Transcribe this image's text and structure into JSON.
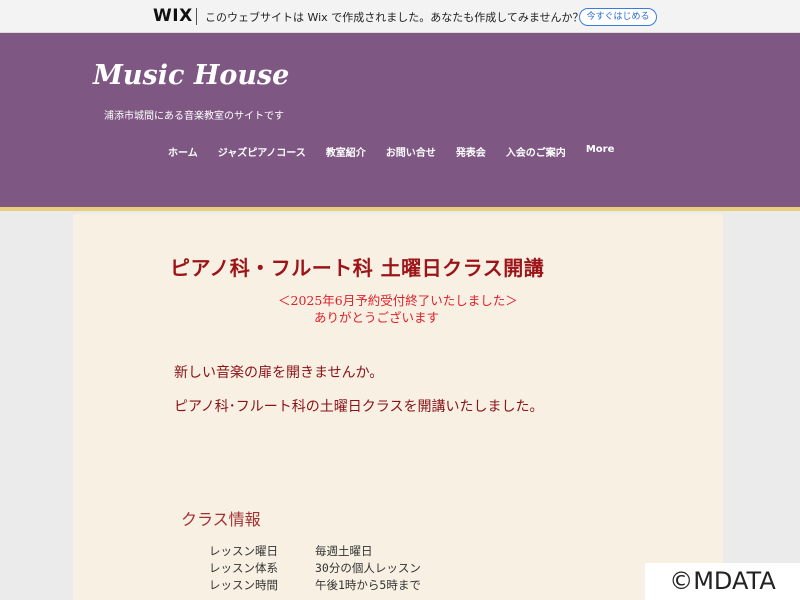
{
  "wix_banner": {
    "logo": "WIX",
    "text": "このウェブサイトは Wix で作成されました。あなたも作成してみませんか？",
    "cta": "今すぐはじめる"
  },
  "header": {
    "title": "Music House",
    "subtitle": "浦添市城間にある音楽教室のサイトです"
  },
  "nav": [
    {
      "label": "ホーム"
    },
    {
      "label": "ジャズピアノコース"
    },
    {
      "label": "教室紹介"
    },
    {
      "label": "お問い合せ"
    },
    {
      "label": "発表会"
    },
    {
      "label": "入会のご案内"
    },
    {
      "label": "More"
    }
  ],
  "main": {
    "heading": "ピアノ科・フルート科 土曜日クラス開講",
    "notice_line1": "＜2025年6月予約受付終了いたしました＞",
    "notice_line2": "ありがとうございます",
    "para1": "新しい音楽の扉を開きませんか。",
    "para2": "ピアノ科･フルート科の土曜日クラスを開講いたしました。",
    "class_info_title": "クラス情報",
    "class_info": [
      {
        "label": "レッスン曜日",
        "value": "毎週土曜日"
      },
      {
        "label": "レッスン体系",
        "value": "30分の個人レッスン"
      },
      {
        "label": "レッスン時間",
        "value": "午後1時から5時まで"
      }
    ]
  },
  "watermark": "©MDATA",
  "colors": {
    "header_bg": "#7e5883",
    "accent_line": "#e9cf7c",
    "panel_bg": "#f7f0e3",
    "heading_red": "#9c1418",
    "notice_red": "#e0212b"
  }
}
